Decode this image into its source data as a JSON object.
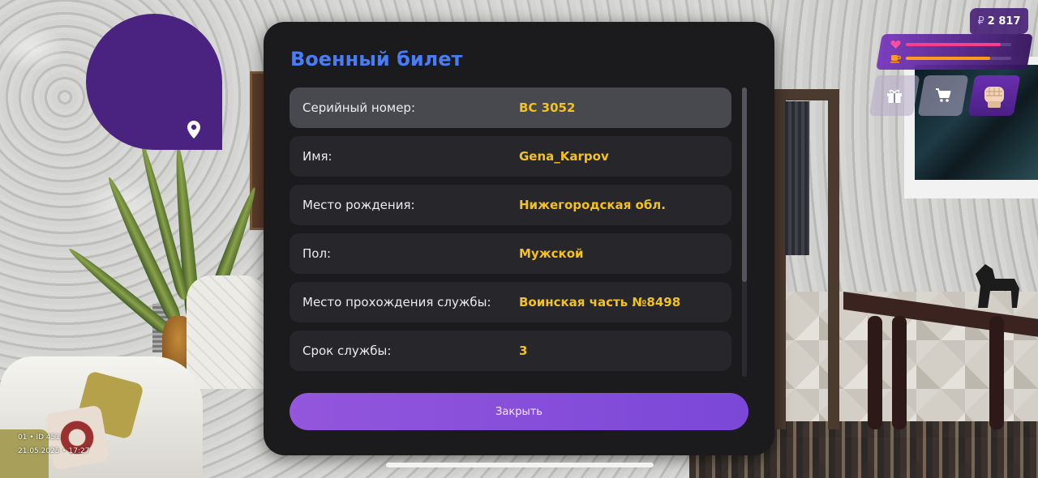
{
  "dialog": {
    "title": "Военный билет",
    "rows": [
      {
        "label": "Серийный номер:",
        "value": "ВС 3052"
      },
      {
        "label": "Имя:",
        "value": "Gena_Karpov"
      },
      {
        "label": "Место рождения:",
        "value": "Нижегородская обл."
      },
      {
        "label": "Пол:",
        "value": "Мужской"
      },
      {
        "label": "Место прохождения службы:",
        "value": "Воинская часть №8498"
      },
      {
        "label": "Срок службы:",
        "value": "3"
      }
    ],
    "active_row": 0,
    "close_label": "Закрыть"
  },
  "hud": {
    "currency_symbol": "₽",
    "money": "2 817",
    "health_level": 0.9,
    "hunger_level": 0.8,
    "icons": [
      "heart-icon",
      "coffee-icon",
      "gift-icon",
      "cart-icon",
      "fist-icon",
      "map-pin-icon"
    ]
  },
  "build_info": {
    "line1": "01 • ID 451",
    "line2": "21.05.2025 • 17:27"
  },
  "colors": {
    "title": "#4a7cf3",
    "value": "#f4c21d",
    "button": "#8a50db",
    "minimap": "#4a2380",
    "health": "#ff3d8a",
    "hunger": "#ff9a1a"
  }
}
